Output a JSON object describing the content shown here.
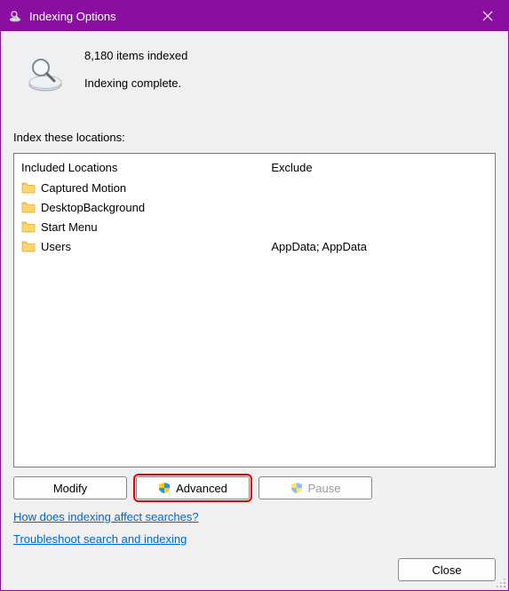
{
  "window": {
    "title": "Indexing Options"
  },
  "status": {
    "count_line": "8,180 items indexed",
    "state_line": "Indexing complete."
  },
  "locations": {
    "label": "Index these locations:",
    "header_included": "Included Locations",
    "header_exclude": "Exclude",
    "items": [
      {
        "name": "Captured Motion",
        "exclude": ""
      },
      {
        "name": "DesktopBackground",
        "exclude": ""
      },
      {
        "name": "Start Menu",
        "exclude": ""
      },
      {
        "name": "Users",
        "exclude": "AppData; AppData"
      }
    ]
  },
  "buttons": {
    "modify": "Modify",
    "advanced": "Advanced",
    "pause": "Pause",
    "close": "Close"
  },
  "links": {
    "affect": "How does indexing affect searches?",
    "troubleshoot": "Troubleshoot search and indexing"
  },
  "icons": {
    "app": "magnifier-drive-icon",
    "folder": "folder-icon",
    "shield": "uac-shield-icon",
    "close": "close-icon"
  }
}
